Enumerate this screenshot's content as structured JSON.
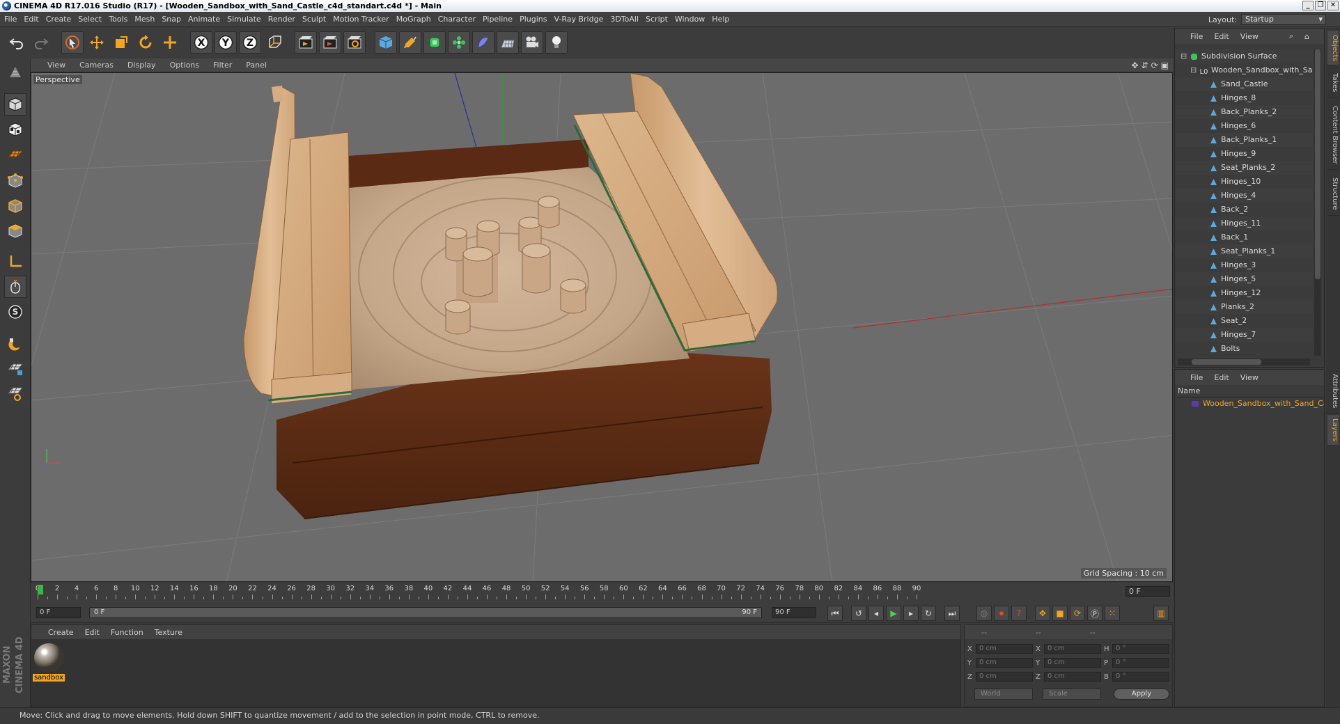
{
  "window": {
    "title": "CINEMA 4D R17.016 Studio (R17) - [Wooden_Sandbox_with_Sand_Castle_c4d_standart.c4d *] - Main",
    "controls": [
      "_",
      "❐",
      "✕"
    ]
  },
  "menubar": {
    "items": [
      "File",
      "Edit",
      "Create",
      "Select",
      "Tools",
      "Mesh",
      "Snap",
      "Animate",
      "Simulate",
      "Render",
      "Sculpt",
      "Motion Tracker",
      "MoGraph",
      "Character",
      "Pipeline",
      "Plugins",
      "V-Ray Bridge",
      "3DToAll",
      "Script",
      "Window",
      "Help"
    ],
    "layout_label": "Layout:",
    "layout_value": "Startup"
  },
  "toolbar": {
    "icons": [
      "undo-icon",
      "redo-icon",
      "live-selection-icon",
      "move-icon",
      "scale-icon",
      "rotate-icon",
      "recent-tool-icon",
      "x-axis-lock-icon",
      "y-axis-lock-icon",
      "z-axis-lock-icon",
      "coordinate-system-icon",
      "render-view-icon",
      "render-to-picture-viewer-icon",
      "render-settings-icon",
      "cube-object-icon",
      "pen-spline-icon",
      "subdivision-surface-icon",
      "cloner-icon",
      "deformer-icon",
      "floor-scene-icon",
      "camera-icon",
      "light-icon"
    ],
    "axis_labels": [
      "X",
      "Y",
      "Z"
    ]
  },
  "left_tools": [
    "make-editable-icon",
    "model-mode-icon",
    "texture-mode-icon",
    "workplane-icon",
    "points-mode-icon",
    "edges-mode-icon",
    "polygons-mode-icon",
    "axis-mode-icon",
    "tweak-mode-icon",
    "solo-icon",
    "snap-magnet-icon",
    "grid-lock-icon",
    "workplane-lock-icon"
  ],
  "viewport": {
    "menu": [
      "View",
      "Cameras",
      "Display",
      "Options",
      "Filter",
      "Panel"
    ],
    "label": "Perspective",
    "grid_spacing": "Grid Spacing : 10 cm",
    "nav_icons": [
      "pan-icon",
      "dolly-icon",
      "orbit-icon",
      "maximize-view-icon"
    ],
    "colors": {
      "background": "#6c6c6c",
      "grid": "#7a7a7a",
      "wood_dark": "#5a2d17",
      "wood_light": "#d4a97a",
      "sand": "#c4a688"
    }
  },
  "timeline": {
    "ticks": [
      "0",
      "2",
      "4",
      "6",
      "8",
      "10",
      "12",
      "14",
      "16",
      "18",
      "20",
      "22",
      "24",
      "26",
      "28",
      "30",
      "32",
      "34",
      "36",
      "38",
      "40",
      "42",
      "44",
      "46",
      "48",
      "50",
      "52",
      "54",
      "56",
      "58",
      "60",
      "62",
      "64",
      "66",
      "68",
      "70",
      "72",
      "74",
      "76",
      "78",
      "80",
      "82",
      "84",
      "86",
      "88",
      "90"
    ],
    "current_frame": "0 F"
  },
  "transport": {
    "start_field": "0 F",
    "slider_left": "0 F",
    "slider_right": "90 F",
    "end_field": "90 F",
    "buttons": [
      "go-to-start-icon",
      "previous-key-icon",
      "previous-frame-icon",
      "play-icon",
      "next-frame-icon",
      "next-key-icon",
      "go-to-end-icon",
      "record-keys-icon",
      "auto-key-icon",
      "keyframe-selection-icon",
      "key-position-icon",
      "key-scale-icon",
      "key-rotation-icon",
      "key-param-icon",
      "key-pla-icon",
      "timeline-icon"
    ]
  },
  "material_manager": {
    "menu": [
      "Create",
      "Edit",
      "Function",
      "Texture"
    ],
    "materials": [
      {
        "name": "sandbox"
      }
    ]
  },
  "coordinates": {
    "header": [
      "--",
      "--",
      "--"
    ],
    "rows": [
      {
        "a": "X",
        "av": "0 cm",
        "b": "X",
        "bv": "0 cm",
        "c": "H",
        "cv": "0 °"
      },
      {
        "a": "Y",
        "av": "0 cm",
        "b": "Y",
        "bv": "0 cm",
        "c": "P",
        "cv": "0 °"
      },
      {
        "a": "Z",
        "av": "0 cm",
        "b": "Z",
        "bv": "0 cm",
        "c": "B",
        "cv": "0 °"
      }
    ],
    "mode": "World",
    "scale": "Scale",
    "apply": "Apply"
  },
  "object_manager": {
    "menu": [
      "File",
      "Edit",
      "View"
    ],
    "tree": [
      {
        "name": "Subdivision Surface",
        "depth": 0,
        "icon": "subdivision-surface-icon"
      },
      {
        "name": "Wooden_Sandbox_with_Sand_C",
        "depth": 1,
        "icon": "null-object-icon"
      },
      {
        "name": "Sand_Castle",
        "depth": 2,
        "icon": "polygon-object-icon"
      },
      {
        "name": "Hinges_8",
        "depth": 2,
        "icon": "polygon-object-icon"
      },
      {
        "name": "Back_Planks_2",
        "depth": 2,
        "icon": "polygon-object-icon"
      },
      {
        "name": "Hinges_6",
        "depth": 2,
        "icon": "polygon-object-icon"
      },
      {
        "name": "Back_Planks_1",
        "depth": 2,
        "icon": "polygon-object-icon"
      },
      {
        "name": "Hinges_9",
        "depth": 2,
        "icon": "polygon-object-icon"
      },
      {
        "name": "Seat_Planks_2",
        "depth": 2,
        "icon": "polygon-object-icon"
      },
      {
        "name": "Hinges_10",
        "depth": 2,
        "icon": "polygon-object-icon"
      },
      {
        "name": "Hinges_4",
        "depth": 2,
        "icon": "polygon-object-icon"
      },
      {
        "name": "Back_2",
        "depth": 2,
        "icon": "polygon-object-icon"
      },
      {
        "name": "Hinges_11",
        "depth": 2,
        "icon": "polygon-object-icon"
      },
      {
        "name": "Back_1",
        "depth": 2,
        "icon": "polygon-object-icon"
      },
      {
        "name": "Seat_Planks_1",
        "depth": 2,
        "icon": "polygon-object-icon"
      },
      {
        "name": "Hinges_3",
        "depth": 2,
        "icon": "polygon-object-icon"
      },
      {
        "name": "Hinges_5",
        "depth": 2,
        "icon": "polygon-object-icon"
      },
      {
        "name": "Hinges_12",
        "depth": 2,
        "icon": "polygon-object-icon"
      },
      {
        "name": "Planks_2",
        "depth": 2,
        "icon": "polygon-object-icon"
      },
      {
        "name": "Seat_2",
        "depth": 2,
        "icon": "polygon-object-icon"
      },
      {
        "name": "Hinges_7",
        "depth": 2,
        "icon": "polygon-object-icon"
      },
      {
        "name": "Bolts",
        "depth": 2,
        "icon": "polygon-object-icon"
      }
    ]
  },
  "layer_manager": {
    "menu": [
      "File",
      "Edit",
      "View"
    ],
    "column": "Name",
    "layers": [
      {
        "name": "Wooden_Sandbox_with_Sand_Castl",
        "color": "#5d3aa8"
      }
    ]
  },
  "side_tabs": {
    "top": [
      "Objects",
      "Takes",
      "Content Browser",
      "Structure"
    ],
    "bottom": [
      "Attributes",
      "Layers"
    ]
  },
  "status": {
    "text": "Move: Click and drag to move elements. Hold down SHIFT to quantize movement / add to the selection in point mode, CTRL to remove.",
    "brand_1": "MAXON",
    "brand_2": "CINEMA 4D"
  }
}
